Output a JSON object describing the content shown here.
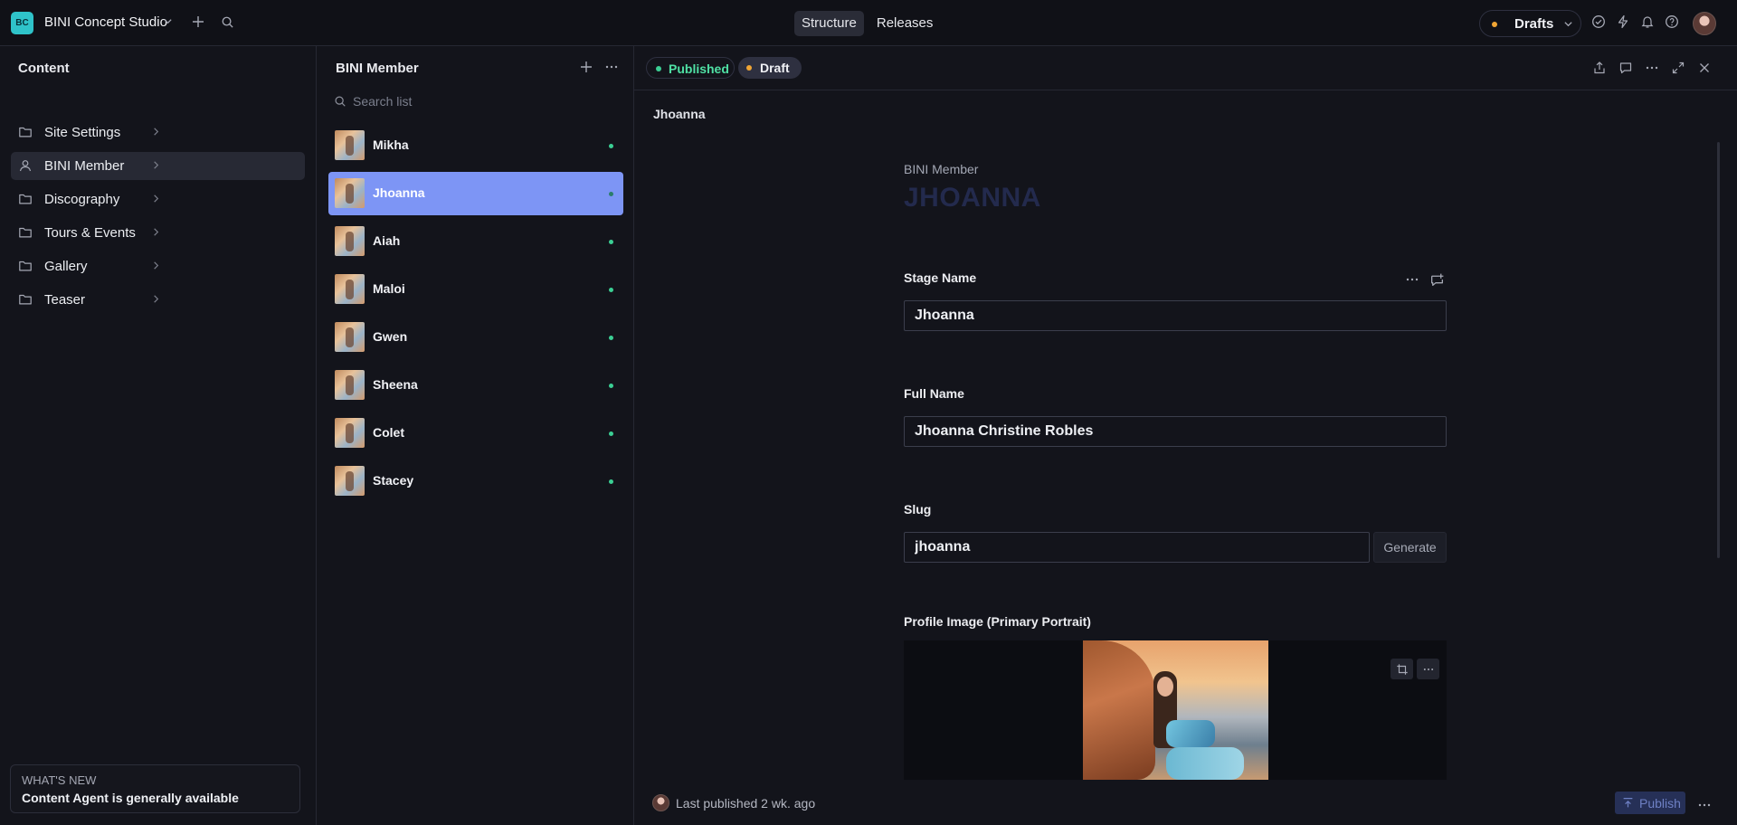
{
  "topbar": {
    "workspace_badge": "BC",
    "workspace_name": "BINI Concept Studio",
    "tabs": [
      {
        "label": "Structure",
        "active": true
      },
      {
        "label": "Releases",
        "active": false
      }
    ],
    "drafts_label": "Drafts"
  },
  "content_pane": {
    "title": "Content",
    "items": [
      {
        "label": "Site Settings",
        "icon": "folder-icon",
        "active": false
      },
      {
        "label": "BINI Member",
        "icon": "user-icon",
        "active": true
      },
      {
        "label": "Discography",
        "icon": "folder-icon",
        "active": false
      },
      {
        "label": "Tours & Events",
        "icon": "folder-icon",
        "active": false
      },
      {
        "label": "Gallery",
        "icon": "folder-icon",
        "active": false
      },
      {
        "label": "Teaser",
        "icon": "folder-icon",
        "active": false
      }
    ],
    "whats_new": {
      "label": "WHAT'S NEW",
      "text": "Content Agent is generally available"
    }
  },
  "member_pane": {
    "title": "BINI Member",
    "search_placeholder": "Search list",
    "members": [
      {
        "name": "Mikha",
        "active": false
      },
      {
        "name": "Jhoanna",
        "active": true
      },
      {
        "name": "Aiah",
        "active": false
      },
      {
        "name": "Maloi",
        "active": false
      },
      {
        "name": "Gwen",
        "active": false
      },
      {
        "name": "Sheena",
        "active": false
      },
      {
        "name": "Colet",
        "active": false
      },
      {
        "name": "Stacey",
        "active": false
      }
    ]
  },
  "document": {
    "published_label": "Published",
    "draft_label": "Draft",
    "title": "Jhoanna",
    "type_label": "BINI Member",
    "heading": "JHOANNA",
    "fields": {
      "stage_name": {
        "label": "Stage Name",
        "value": "Jhoanna"
      },
      "full_name": {
        "label": "Full Name",
        "value": "Jhoanna Christine Robles"
      },
      "slug": {
        "label": "Slug",
        "value": "jhoanna",
        "generate_label": "Generate"
      },
      "profile_image": {
        "label": "Profile Image (Primary Portrait)"
      }
    },
    "footer": {
      "last_published": "Last published 2 wk. ago",
      "publish_label": "Publish"
    }
  },
  "colors": {
    "accent": "#7d95f5",
    "published": "#3bcf94",
    "draft": "#f0a534",
    "workspace": "#2fc3c9"
  }
}
